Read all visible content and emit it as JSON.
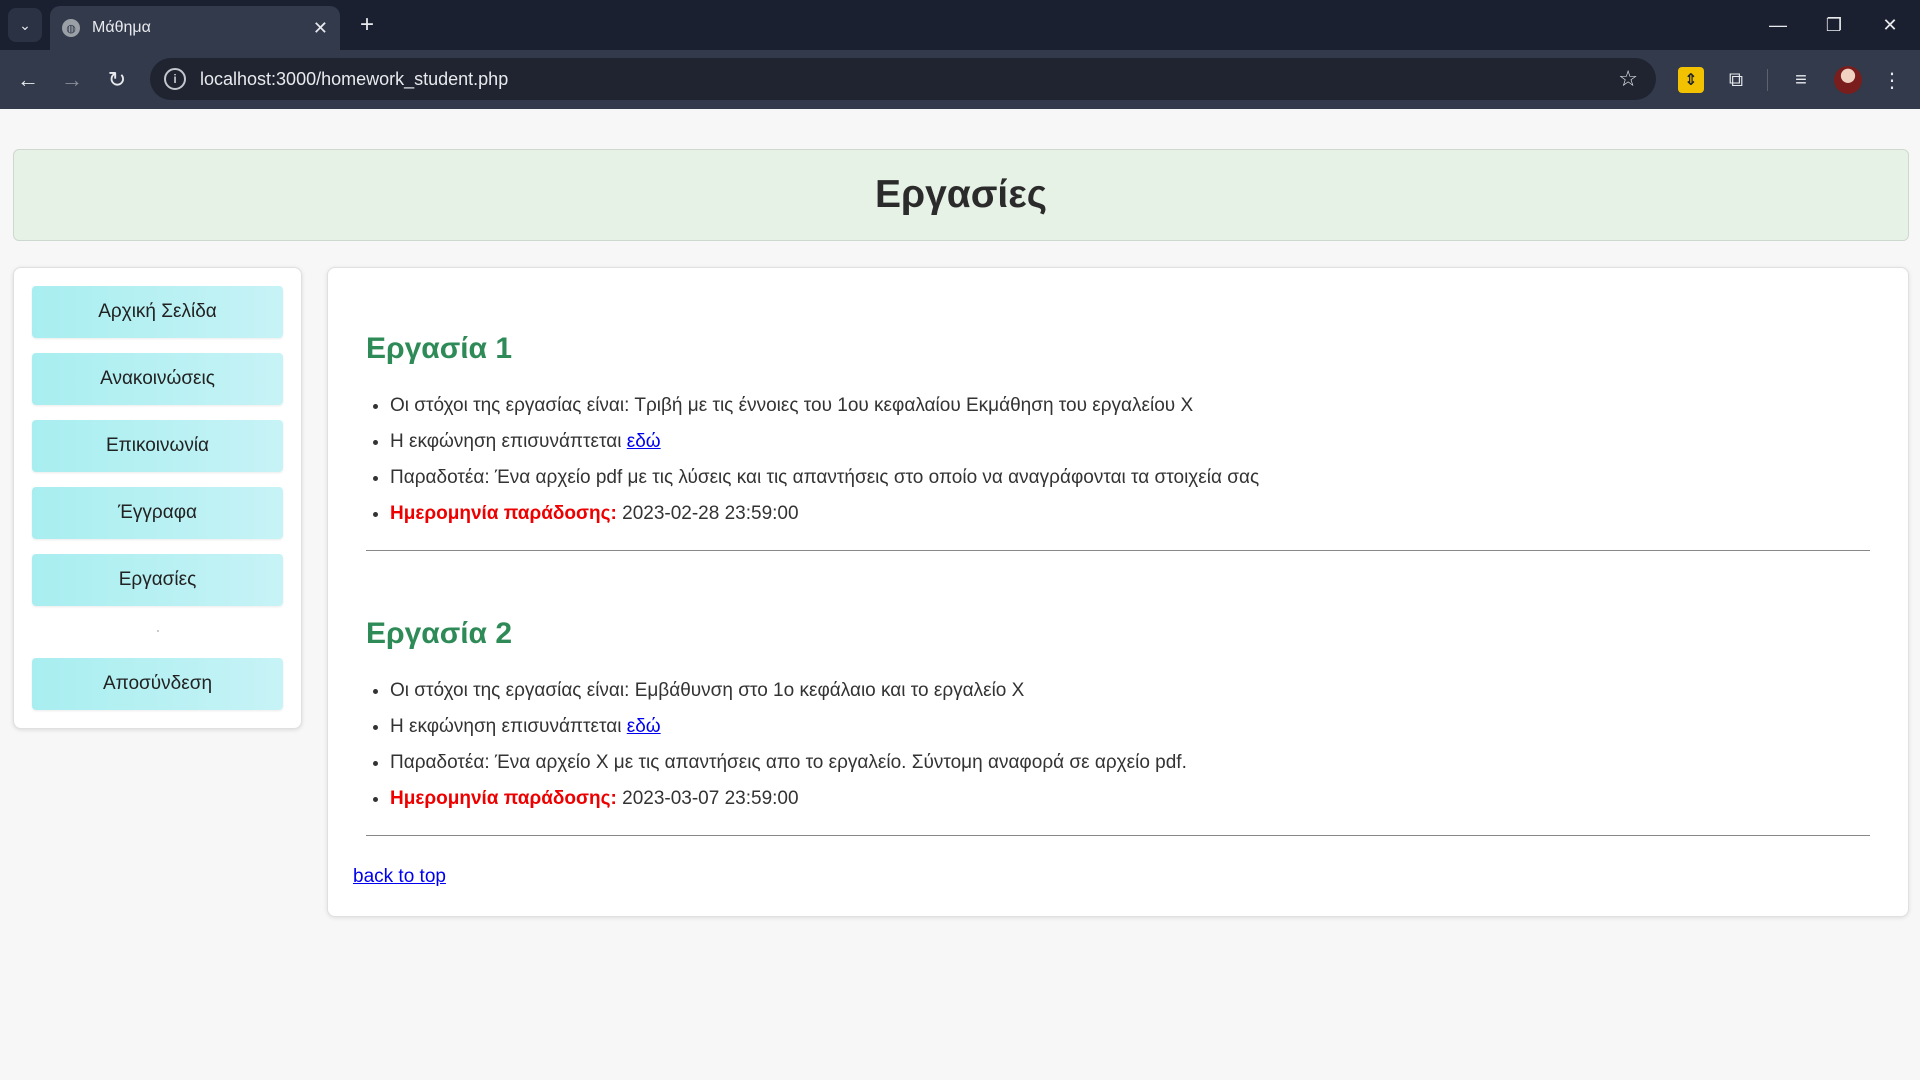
{
  "browser": {
    "tab_title": "Μάθημα",
    "url": "localhost:3000/homework_student.php"
  },
  "page": {
    "title": "Εργασίες"
  },
  "sidebar": {
    "items": [
      {
        "label": "Αρχική Σελίδα"
      },
      {
        "label": "Ανακοινώσεις"
      },
      {
        "label": "Επικοινωνία"
      },
      {
        "label": "Έγγραφα"
      },
      {
        "label": "Εργασίες"
      },
      {
        "label": "Αποσύνδεση"
      }
    ]
  },
  "homeworks": [
    {
      "title": "Εργασία 1",
      "goals": "Οι στόχοι της εργασίας είναι: Τριβή με τις έννοιες του 1ου κεφαλαίου Εκμάθηση του εργαλείου Χ",
      "statement_text": "Η εκφώνηση επισυνάπτεται",
      "statement_link": "εδώ",
      "deliverables": "Παραδοτέα: Ένα αρχείο pdf με τις λύσεις και τις απαντήσεις στο οποίο να αναγράφονται τα στοιχεία σας",
      "due_label": "Ημερομηνία παράδοσης:",
      "due_date": "2023-02-28 23:59:00"
    },
    {
      "title": "Εργασία 2",
      "goals": "Οι στόχοι της εργασίας είναι: Εμβάθυνση στο 1ο κεφάλαιο και το εργαλείο Χ",
      "statement_text": "Η εκφώνηση επισυνάπτεται",
      "statement_link": "εδώ",
      "deliverables": "Παραδοτέα: Ένα αρχείο Χ με τις απαντήσεις απο το εργαλείο. Σύντομη αναφορά σε αρχείο pdf.",
      "due_label": "Ημερομηνία παράδοσης:",
      "due_date": "2023-03-07 23:59:00"
    }
  ],
  "back_to_top": "back to top",
  "icons": {
    "tab_search": "chevron-down-icon",
    "favicon": "globe-icon",
    "close": "close-icon",
    "new_tab": "plus-icon",
    "back": "arrow-left-icon",
    "forward": "arrow-right-icon",
    "reload": "reload-icon",
    "site_info": "info-icon",
    "bookmark": "star-icon",
    "extensions": "puzzle-icon",
    "media": "media-queue-icon",
    "menu": "kebab-menu-icon"
  },
  "colors": {
    "homework_title": "#2e8b57",
    "due_label": "#ee0000",
    "nav_button": "#a8eef0",
    "header_bg": "#e6f2e6",
    "link": "#0000ee"
  }
}
